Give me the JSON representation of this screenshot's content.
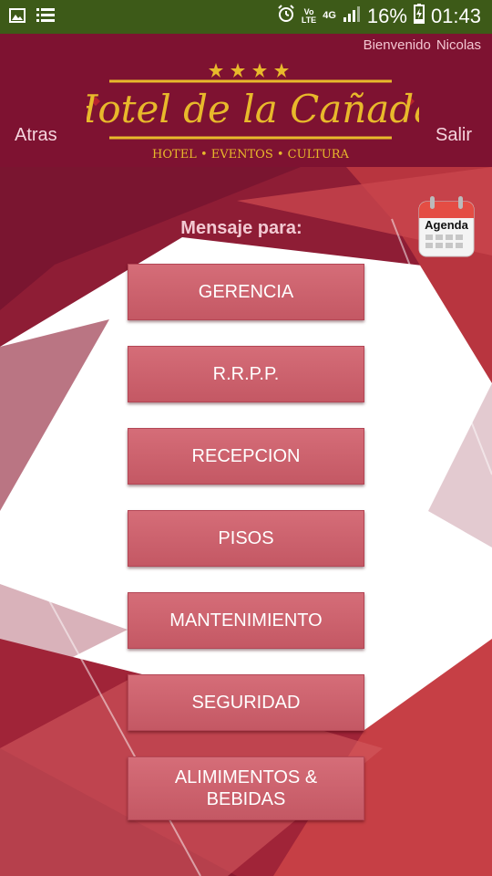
{
  "status_bar": {
    "battery": "16%",
    "time": "01:43",
    "network": "4G",
    "volte_top": "Vo",
    "volte_bottom": "LTE"
  },
  "header": {
    "welcome": "Bienvenido",
    "user": "Nicolas",
    "back_label": "Atras",
    "logout_label": "Salir",
    "logo_title": "Hotel de la Cañada",
    "logo_subtitle": "HOTEL • EVENTOS • CULTURA",
    "brand_color": "#7e1231"
  },
  "main": {
    "prompt": "Mensaje para:",
    "agenda_label": "Agenda",
    "buttons": [
      {
        "label": "GERENCIA"
      },
      {
        "label": "R.R.P.P."
      },
      {
        "label": "RECEPCION"
      },
      {
        "label": "PISOS"
      },
      {
        "label": "MANTENIMIENTO"
      },
      {
        "label": "SEGURIDAD"
      },
      {
        "label": "ALIMIMENTOS & BEBIDAS"
      }
    ]
  }
}
